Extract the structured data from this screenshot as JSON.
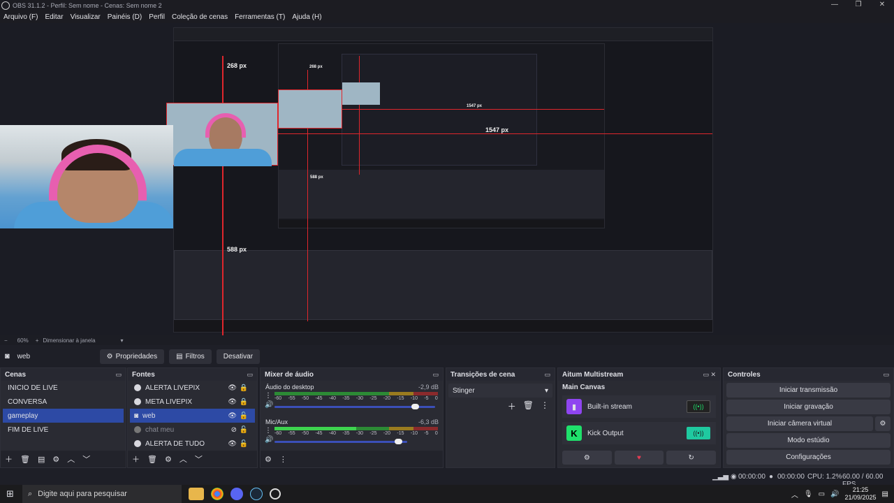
{
  "window": {
    "title": "OBS 31.1.2 - Perfil: Sem nome - Cenas: Sem nome 2",
    "controls": [
      "—",
      "❐",
      "✕"
    ]
  },
  "menu": [
    "Arquivo (F)",
    "Editar",
    "Visualizar",
    "Painéis (D)",
    "Perfil",
    "Coleção de cenas",
    "Ferramentas (T)",
    "Ajuda (H)"
  ],
  "preview": {
    "guide_top": "268 px",
    "guide_right": "1547 px",
    "guide_bottom": "588 px",
    "nested_guide_top": "268 px",
    "nested_guide_right": "1547 px",
    "nested_guide_bottom": "588 px"
  },
  "zoom_bar": {
    "minus": "−",
    "zoom": "60%",
    "plus": "+",
    "scale_mode": "Dimensionar à janela"
  },
  "source_bar": {
    "selected_source": "web",
    "properties": "Propriedades",
    "filters": "Filtros",
    "deactivate": "Desativar"
  },
  "scenes": {
    "title": "Cenas",
    "items": [
      "INICIO DE LIVE",
      "CONVERSA",
      "gameplay",
      "FIM DE LIVE"
    ],
    "selected": "gameplay"
  },
  "sources": {
    "title": "Fontes",
    "items": [
      {
        "name": "ALERTA LIVEPIX",
        "visible": true
      },
      {
        "name": "META LIVEPIX",
        "visible": true
      },
      {
        "name": "web",
        "visible": true,
        "selected": true
      },
      {
        "name": "chat meu",
        "visible": false
      },
      {
        "name": "ALERTA DE TUDO",
        "visible": true
      }
    ]
  },
  "mixer": {
    "title": "Mixer de áudio",
    "channels": [
      {
        "name": "Áudio do desktop",
        "db": "-2,9 dB",
        "volume": 0.88
      },
      {
        "name": "Mic/Aux",
        "db": "-6,3 dB",
        "volume": 0.73
      }
    ],
    "ticks": [
      "-60",
      "-55",
      "-50",
      "-45",
      "-40",
      "-35",
      "-30",
      "-25",
      "-20",
      "-15",
      "-10",
      "-5",
      "0"
    ]
  },
  "transitions": {
    "title": "Transições de cena",
    "selected": "Stinger"
  },
  "multistream": {
    "title": "Aitum Multistream",
    "canvas": "Main Canvas",
    "outputs": [
      {
        "name": "Built-in stream",
        "active": false
      },
      {
        "name": "Kick Output",
        "active": true
      }
    ]
  },
  "controls": {
    "title": "Controles",
    "start_stream": "Iniciar transmissão",
    "start_record": "Iniciar gravação",
    "start_vcam": "Iniciar câmera virtual",
    "studio_mode": "Modo estúdio",
    "settings": "Configurações"
  },
  "statusbar": {
    "stream_time": "00:00:00",
    "record_time": "00:00:00",
    "cpu": "CPU: 1.2%",
    "fps": "60.00 / 60.00 FPS"
  },
  "taskbar": {
    "search_placeholder": "Digite aqui para pesquisar",
    "time": "21:25",
    "date": "21/09/2025"
  },
  "colors": {
    "accent": "#2d4aa5",
    "guide_red": "#e0262c",
    "kick_green": "#1fe06b",
    "twitch_purple": "#8f45f0"
  }
}
